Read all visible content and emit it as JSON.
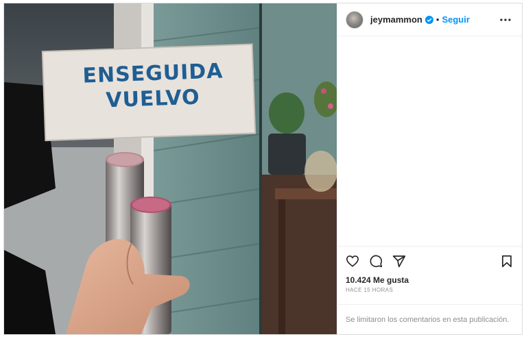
{
  "post": {
    "photo": {
      "sign_line1": "ENSEGUIDA",
      "sign_line2": "VUELVO"
    },
    "header": {
      "username": "jeymammon",
      "separator": "•",
      "follow_label": "Seguir"
    },
    "stats": {
      "likes": "10.424 Me gusta",
      "time": "HACE 15 HORAS"
    },
    "comments_notice": "Se limitaron los comentarios en esta publicación."
  },
  "colors": {
    "follow": "#0095f6",
    "verified": "#0095f6",
    "sign_text": "#1f5e93"
  },
  "icons": [
    "verified-badge-icon",
    "more-options-icon",
    "heart-icon",
    "comment-icon",
    "share-icon",
    "bookmark-icon"
  ]
}
